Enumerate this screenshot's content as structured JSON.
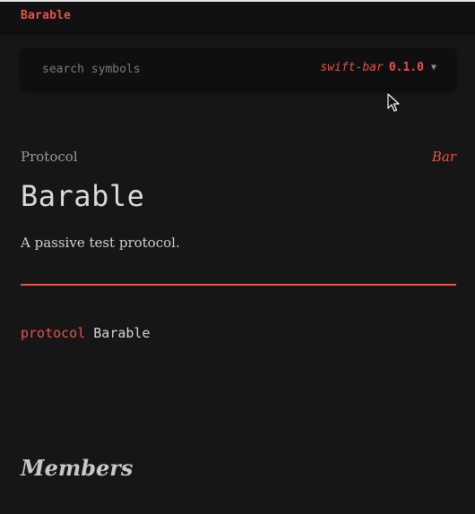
{
  "header": {
    "brand": "Barable"
  },
  "search": {
    "placeholder": "search symbols",
    "package_name": "swift-bar",
    "package_version": "0.1.0"
  },
  "symbol": {
    "kind": "Protocol",
    "module": "Bar",
    "title": "Barable",
    "abstract": "A passive test protocol.",
    "declaration": {
      "keyword": "protocol",
      "name": "Barable"
    }
  },
  "sections": {
    "members_title": "Members"
  },
  "colors": {
    "accent": "#e5534b",
    "background": "#161616",
    "topbar": "#111111",
    "text": "#d6d6d6",
    "muted": "#9a9a9a"
  },
  "icons": {
    "dropdown": "chevron-down-icon",
    "cursor": "mouse-cursor-icon"
  }
}
